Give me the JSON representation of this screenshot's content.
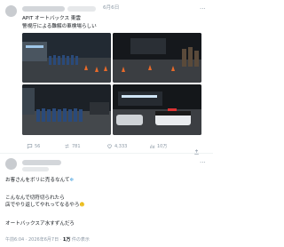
{
  "post1": {
    "time": "6月6日",
    "line1": "APIT オートバックス 東雲",
    "line2": "警視庁による難解の車検場らしい",
    "stats": {
      "replies": "56",
      "reposts": "781",
      "likes": "4,333",
      "views": "10万"
    }
  },
  "post2": {
    "line1": "お客さんをボリに売るなんて",
    "line2": "こんなんで切符切られたら",
    "line3": "店でやり返してやれってなるやろ",
    "line4": "オートバックスア水すずんだろ",
    "meta_time": "午前6:04 · 2026年6月7日 · ",
    "meta_views_count": "1万",
    "meta_views_label": " 件の表示"
  }
}
